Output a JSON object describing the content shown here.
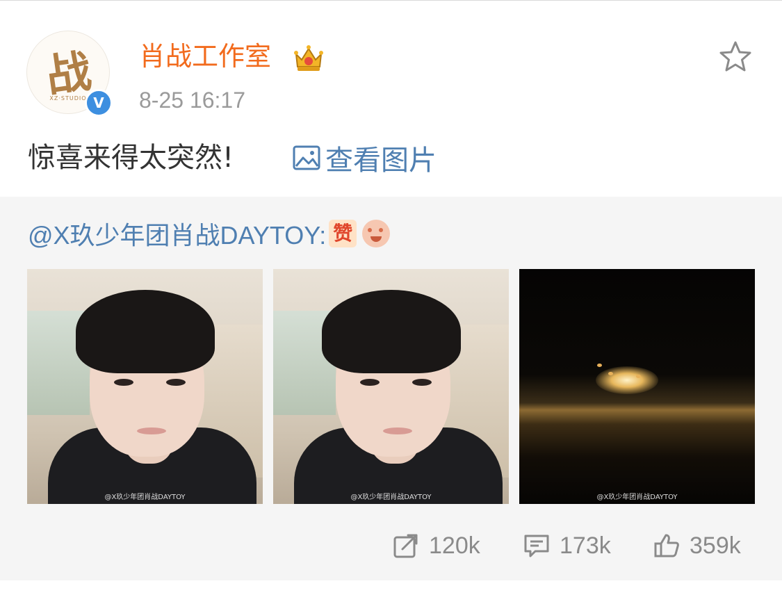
{
  "post": {
    "author": "肖战工作室",
    "avatar_text": "战",
    "avatar_subtext": "XZ·STUDIO",
    "verified_icon": "V",
    "time": "8-25 16:17",
    "text": "惊喜来得太突然!",
    "view_images_label": "查看图片"
  },
  "repost": {
    "author_line": "@X玖少年团肖战DAYTOY:",
    "emoji_zan": "赞",
    "photos": [
      {
        "type": "selfie",
        "watermark": "@X玖少年团肖战DAYTOY"
      },
      {
        "type": "selfie",
        "watermark": "@X玖少年团肖战DAYTOY"
      },
      {
        "type": "night-road",
        "watermark": "@X玖少年团肖战DAYTOY"
      }
    ]
  },
  "actions": {
    "repost_count": "120k",
    "comment_count": "173k",
    "like_count": "359k"
  },
  "colors": {
    "author": "#f26b1d",
    "link": "#4f7fb1",
    "muted": "#9a9a9a",
    "repost_bg": "#f5f5f5"
  },
  "icons": [
    "crown-icon",
    "star-icon",
    "image-icon",
    "repost-icon",
    "comment-icon",
    "like-icon"
  ]
}
